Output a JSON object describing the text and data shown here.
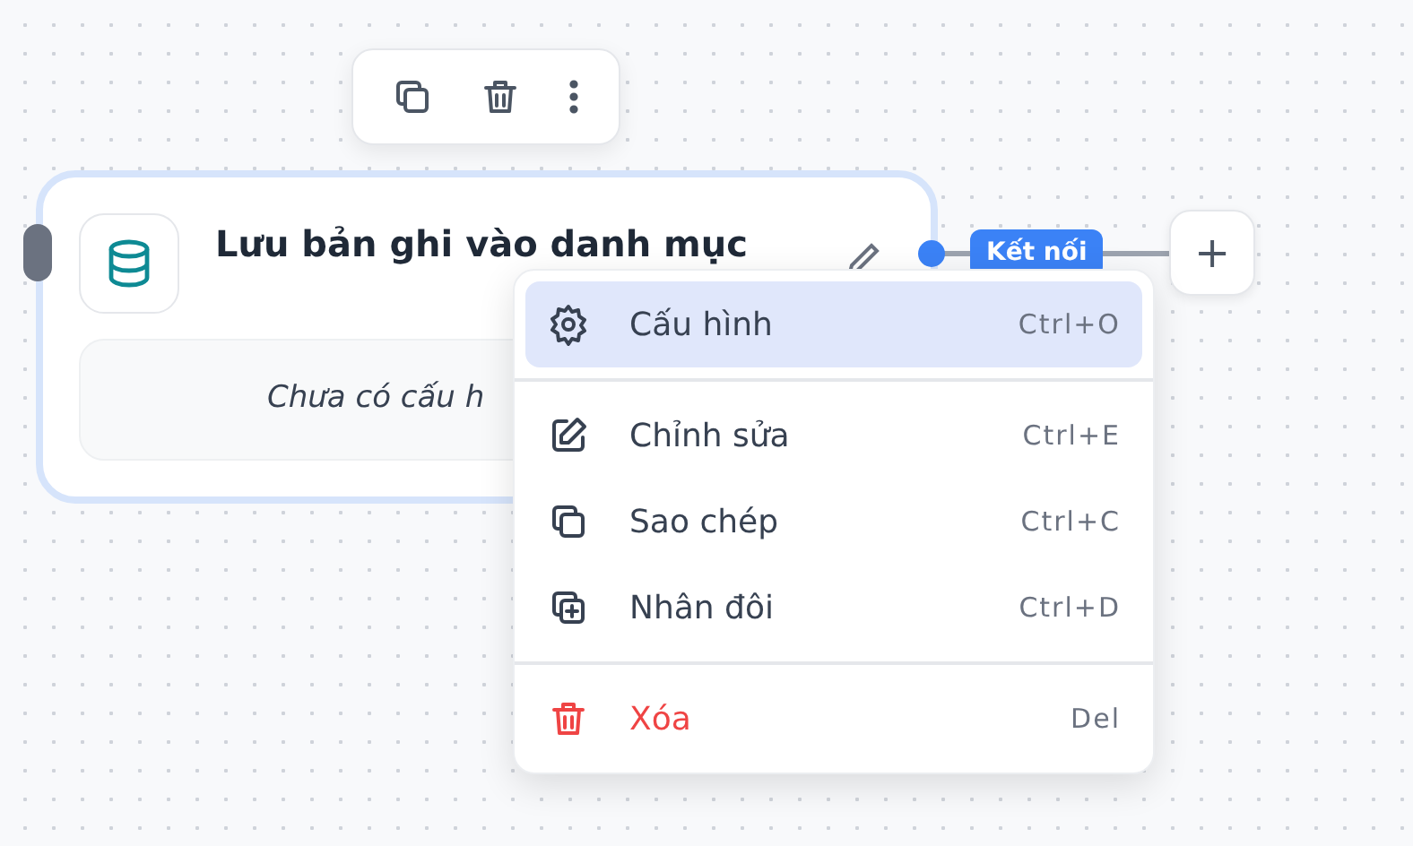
{
  "node_toolbar": {
    "buttons": [
      {
        "kind": "copy"
      },
      {
        "kind": "delete"
      },
      {
        "kind": "more"
      }
    ]
  },
  "node": {
    "title": "Lưu bản ghi vào danh mục",
    "placeholder_text": "Chưa có cấu h",
    "selected": true
  },
  "connection": {
    "label": "Kết nối",
    "add_button": "+"
  },
  "context_menu": {
    "groups": [
      [
        {
          "label": "Cấu hình",
          "shortcut": "Ctrl+O",
          "kind": "settings",
          "selected": true
        }
      ],
      [
        {
          "label": "Chỉnh sửa",
          "shortcut": "Ctrl+E",
          "kind": "edit",
          "selected": false
        },
        {
          "label": "Sao chép",
          "shortcut": "Ctrl+C",
          "kind": "copy",
          "selected": false
        },
        {
          "label": "Nhân đôi",
          "shortcut": "Ctrl+D",
          "kind": "duplicate",
          "selected": false
        }
      ],
      [
        {
          "label": "Xóa",
          "shortcut": "Del",
          "kind": "delete",
          "selected": false
        }
      ]
    ]
  }
}
